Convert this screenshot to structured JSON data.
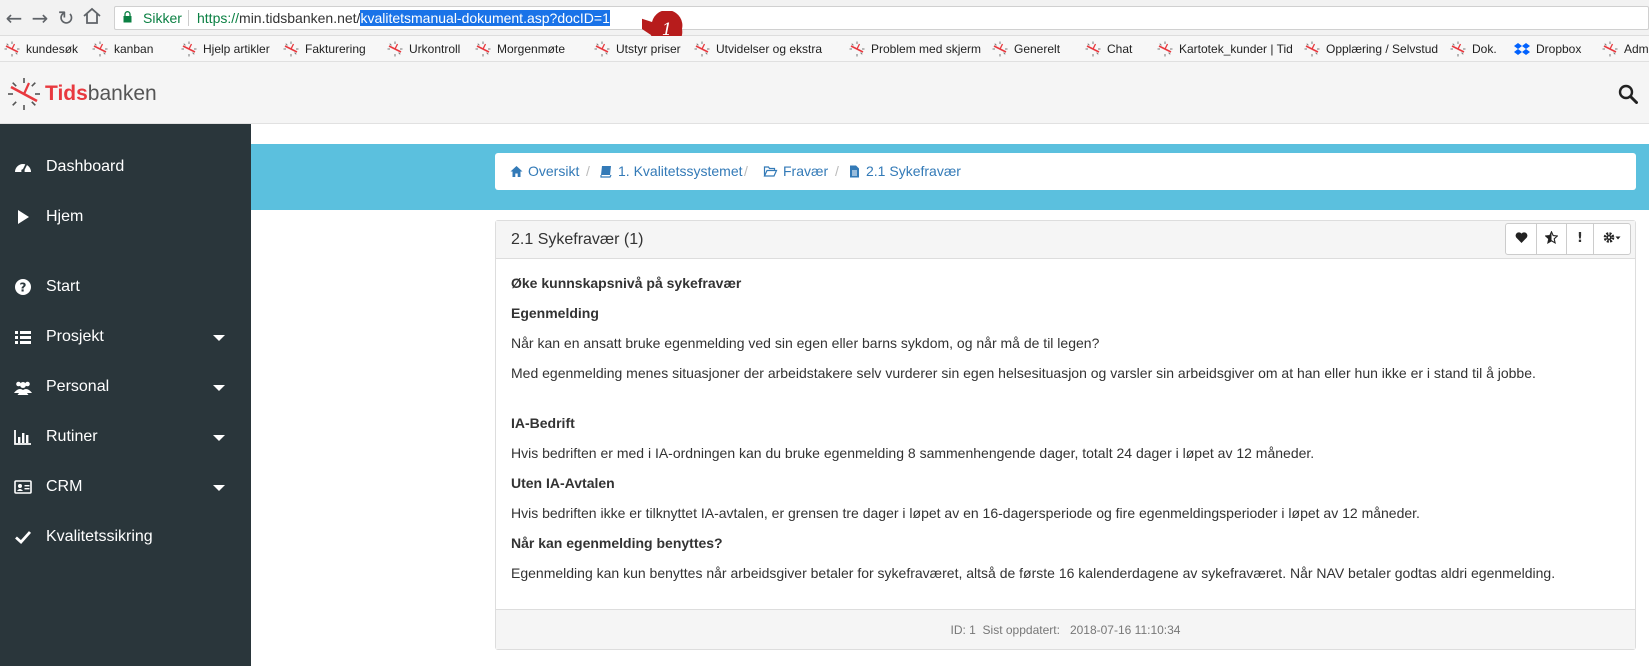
{
  "browser": {
    "secure_label": "Sikker",
    "url_protocol": "https://",
    "url_host": "min.tidsbanken.net/",
    "url_path": "kvalitetsmanual-dokument.asp?docID=1",
    "annotation_number": "1",
    "bookmarks": [
      "kundesøk",
      "kanban",
      "Hjelp artikler",
      "Fakturering",
      "Urkontroll",
      "Morgenmøte",
      "Utstyr priser",
      "Utvidelser og ekstra",
      "Problem med skjerm",
      "Generelt",
      "Chat",
      "Kartotek_kunder | Tid",
      "Opplæring / Selvstud",
      "Dok.",
      "Dropbox",
      "Adm"
    ]
  },
  "app": {
    "logo_bold": "Tids",
    "logo_rest": "banken"
  },
  "sidebar": {
    "items": [
      {
        "label": "Dashboard",
        "icon": "dashboard-icon"
      },
      {
        "label": "Hjem",
        "icon": "play-icon"
      },
      {
        "label": "Start",
        "icon": "question-circle-icon"
      },
      {
        "label": "Prosjekt",
        "icon": "list-icon"
      },
      {
        "label": "Personal",
        "icon": "users-icon"
      },
      {
        "label": "Rutiner",
        "icon": "bar-chart-icon"
      },
      {
        "label": "CRM",
        "icon": "id-card-icon"
      },
      {
        "label": "Kvalitetssikring",
        "icon": "check-icon"
      }
    ]
  },
  "breadcrumb": {
    "items": [
      "Oversikt",
      "1. Kvalitetssystemet",
      "Fravær",
      "2.1 Sykefravær"
    ],
    "separator": "/"
  },
  "document": {
    "title": "2.1 Sykefravær (1)",
    "paragraphs": [
      "Øke kunnskapsnivå på sykefravær",
      "Egenmelding",
      "Når kan en ansatt bruke egenmelding ved sin egen eller barns sykdom, og når må de til legen?",
      "Med egenmelding menes situasjoner der arbeidstakere selv vurderer sin egen helsesituasjon og varsler sin arbeidsgiver om at han eller hun ikke er i stand til å jobbe.",
      "IA-Bedrift",
      "Hvis bedriften er med i IA-ordningen kan du bruke egenmelding 8 sammenhengende dager, totalt 24 dager i løpet av 12 måneder.",
      "Uten IA-Avtalen",
      "Hvis bedriften ikke er tilknyttet IA-avtalen, er grensen tre dager i løpet av en 16-dagersperiode og fire egenmeldingsperioder i løpet av 12 måneder.",
      "Når kan egenmelding benyttes?",
      "Egenmelding kan kun benyttes når arbeidsgiver betaler for sykefraværet, altså de første 16 kalenderdagene av sykefraværet. Når NAV betaler godtas aldri egenmelding."
    ],
    "footer_id_label": "ID: 1",
    "footer_updated_label": "Sist oppdatert:",
    "footer_updated_value": "2018-07-16 11:10:34"
  },
  "colors": {
    "sidebar": "#2a363b",
    "banner": "#5bc0de",
    "link": "#337ab7",
    "brand_red": "#e8393f"
  }
}
